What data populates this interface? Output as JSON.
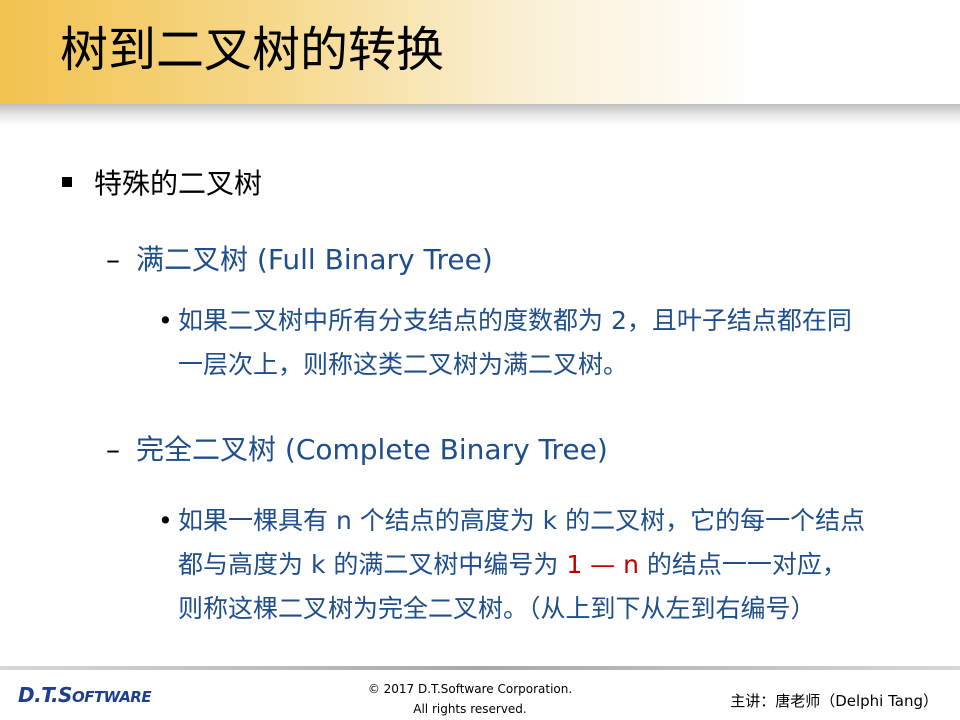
{
  "slide": {
    "title": "树到二叉树的转换"
  },
  "content": {
    "bullet1": "特殊的二叉树",
    "full": {
      "heading": "满二叉树 (Full Binary Tree)",
      "desc_line1": "如果二叉树中所有分支结点的度数都为 2，且叶子结点都在同",
      "desc_line2": "一层次上，则称这类二叉树为满二叉树。"
    },
    "complete": {
      "heading": "完全二叉树 (Complete Binary Tree)",
      "desc_line1": "如果一棵具有 n 个结点的高度为 k 的二叉树，它的每一个结点",
      "desc_line2_pre": "都与高度为 k 的满二叉树中编号为 ",
      "desc_line2_highlight": "1 — n",
      "desc_line2_post": " 的结点一一对应，",
      "desc_line3": "则称这棵二叉树为完全二叉树。（从上到下从左到右编号）"
    }
  },
  "footer": {
    "logo_dt": "D.T.",
    "logo_s": "S",
    "logo_rest": "OFTWARE",
    "copyright_line1": "© 2017 D.T.Software Corporation.",
    "copyright_line2": "All rights reserved.",
    "presenter": "主讲：唐老师（Delphi Tang）"
  },
  "colors": {
    "accent": "#f2c24f",
    "text_blue": "#1f4e8c",
    "highlight_red": "#c00000",
    "logo_blue": "#1c3f8f"
  }
}
